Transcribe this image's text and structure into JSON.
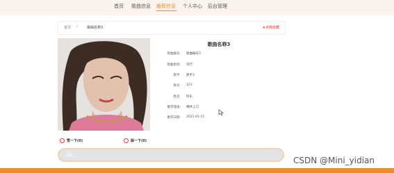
{
  "nav": {
    "items": [
      {
        "label": "首页",
        "active": false
      },
      {
        "label": "歌曲信息",
        "active": false
      },
      {
        "label": "推荐信息",
        "active": true
      },
      {
        "label": "个人中心",
        "active": false
      },
      {
        "label": "后台管理",
        "active": false
      }
    ],
    "accent_color": "#f08a24"
  },
  "breadcrumb": {
    "home": "首页",
    "separator": "/",
    "current": "歌曲名称3",
    "favorite_label": "★点我收藏"
  },
  "song": {
    "title": "歌曲名称3",
    "fields": [
      {
        "label": "歌曲编号:",
        "value": "歌曲编号3"
      },
      {
        "label": "歌曲类别:",
        "value": "流行"
      },
      {
        "label": "歌手:",
        "value": "歌手3"
      },
      {
        "label": "账号:",
        "value": "123"
      },
      {
        "label": "姓名:",
        "value": "阿乐"
      },
      {
        "label": "推荐理由:",
        "value": "横林上口"
      },
      {
        "label": "推荐日期:",
        "value": "2021-01-15"
      }
    ]
  },
  "votes": {
    "up_label": "赞一下(0)",
    "down_label": "踩一下(0)"
  },
  "comment": {
    "placeholder": "评论"
  },
  "watermark": "CSDN @Mini_yidian"
}
